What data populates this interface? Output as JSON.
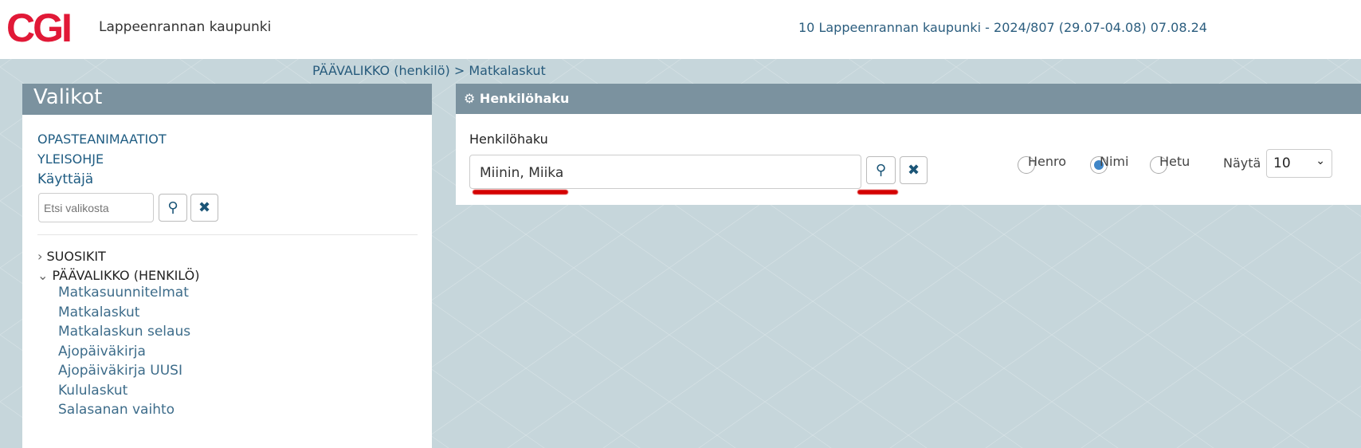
{
  "header": {
    "logo": "CGI",
    "organization": "Lappeenrannan kaupunki",
    "context": "10 Lappeenrannan kaupunki - 2024/807 (29.07-04.08) 07.08.24"
  },
  "breadcrumb": "PÄÄVALIKKO (henkilö) > Matkalaskut",
  "menu": {
    "title": "Valikot",
    "links": [
      "OPASTEANIMAATIOT",
      "YLEISOHJE",
      "Käyttäjä"
    ],
    "search_placeholder": "Etsi valikosta",
    "groups": [
      {
        "label": "SUOSIKIT",
        "expanded": false
      },
      {
        "label": "PÄÄVALIKKO (HENKILÖ)",
        "expanded": true,
        "items": [
          "Matkasuunnitelmat",
          "Matkalaskut",
          "Matkalaskun selaus",
          "Ajopäiväkirja",
          "Ajopäiväkirja UUSI",
          "Kululaskut",
          "Salasanan vaihto"
        ]
      }
    ]
  },
  "search": {
    "title": "Henkilöhaku",
    "label": "Henkilöhaku",
    "value": "Miinin, Miika",
    "options": [
      "Henro",
      "Nimi",
      "Hetu"
    ],
    "selected": "Nimi",
    "show_label": "Näytä",
    "show_value": "10"
  },
  "colors": {
    "brand": "#e11937",
    "panel_header": "#7b929f",
    "link": "#1f5c82",
    "highlight": "#d40000"
  }
}
